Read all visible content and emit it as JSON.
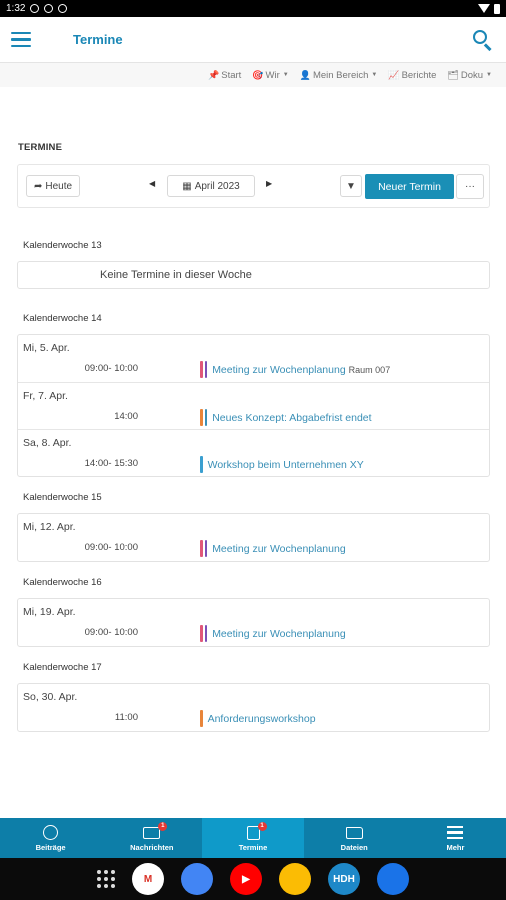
{
  "status_bar": {
    "time": "1:32"
  },
  "app_bar": {
    "title": "Termine"
  },
  "top_links": [
    {
      "label": "Start",
      "icon": "pin-icon",
      "glyph": "📌",
      "has_menu": false
    },
    {
      "label": "Wir",
      "icon": "target-icon",
      "glyph": "🎯",
      "has_menu": true
    },
    {
      "label": "Mein Bereich",
      "icon": "person-icon",
      "glyph": "👤",
      "has_menu": true
    },
    {
      "label": "Berichte",
      "icon": "chart-icon",
      "glyph": "📈",
      "has_menu": false
    },
    {
      "label": "Doku",
      "icon": "folder-icon",
      "glyph": "🗂",
      "has_menu": true
    }
  ],
  "section_title": "TERMINE",
  "toolbar": {
    "today_label": "Heute",
    "month_label": "April 2023",
    "new_event_label": "Neuer Termin",
    "more_label": "···"
  },
  "empty_message": "Keine Termine in dieser Woche",
  "weeks": [
    {
      "label": "Kalenderwoche 13",
      "days": []
    },
    {
      "label": "Kalenderwoche 14",
      "days": [
        {
          "date": "Mi, 5. Apr.",
          "time": "09:00- 10:00",
          "title": "Meeting zur Wochenplanung",
          "room": "Raum 007",
          "colors": [
            "#e0577a",
            "#7b4fb8"
          ]
        },
        {
          "date": "Fr, 7. Apr.",
          "time": "14:00",
          "title": "Neues Konzept: Abgabefrist endet",
          "room": "",
          "colors": [
            "#e8853a",
            "#3a8fb6"
          ]
        },
        {
          "date": "Sa, 8. Apr.",
          "time": "14:00- 15:30",
          "title": "Workshop beim Unternehmen XY",
          "room": "",
          "colors": [
            "#3a9fd0"
          ]
        }
      ]
    },
    {
      "label": "Kalenderwoche 15",
      "days": [
        {
          "date": "Mi, 12. Apr.",
          "time": "09:00- 10:00",
          "title": "Meeting zur Wochenplanung",
          "room": "",
          "colors": [
            "#e0577a",
            "#7b4fb8"
          ]
        }
      ]
    },
    {
      "label": "Kalenderwoche 16",
      "days": [
        {
          "date": "Mi, 19. Apr.",
          "time": "09:00- 10:00",
          "title": "Meeting zur Wochenplanung",
          "room": "",
          "colors": [
            "#e0577a",
            "#7b4fb8"
          ]
        }
      ]
    },
    {
      "label": "Kalenderwoche 17",
      "days": [
        {
          "date": "So, 30. Apr.",
          "time": "11:00",
          "title": "Anforderungsworkshop",
          "room": "",
          "colors": [
            "#e8853a"
          ]
        }
      ]
    }
  ],
  "bottom_nav": [
    {
      "label": "Beiträge",
      "icon": "globe-icon",
      "badge": ""
    },
    {
      "label": "Nachrichten",
      "icon": "inbox-icon",
      "badge": "1"
    },
    {
      "label": "Termine",
      "icon": "calendar-icon",
      "badge": "1",
      "active": true
    },
    {
      "label": "Dateien",
      "icon": "folder-icon",
      "badge": ""
    },
    {
      "label": "Mehr",
      "icon": "menu-icon",
      "badge": ""
    }
  ],
  "dock": [
    {
      "icon": "gmail-icon",
      "text": "M",
      "color": "#ffffff",
      "text_color": "#d93025"
    },
    {
      "icon": "chrome-icon",
      "text": "",
      "color": "#4285f4"
    },
    {
      "icon": "youtube-icon",
      "text": "▶",
      "color": "#ff0000"
    },
    {
      "icon": "photos-icon",
      "text": "",
      "color": "#fbbc04"
    },
    {
      "icon": "hdh-icon",
      "text": "HDH",
      "color": "#1e88c8"
    },
    {
      "icon": "messages-icon",
      "text": "",
      "color": "#1a73e8"
    }
  ],
  "colors": {
    "primary": "#1a87b6",
    "nav_bg": "#0d7ea8",
    "nav_active": "#0f9ac9",
    "button_new": "#1a8fb6"
  }
}
